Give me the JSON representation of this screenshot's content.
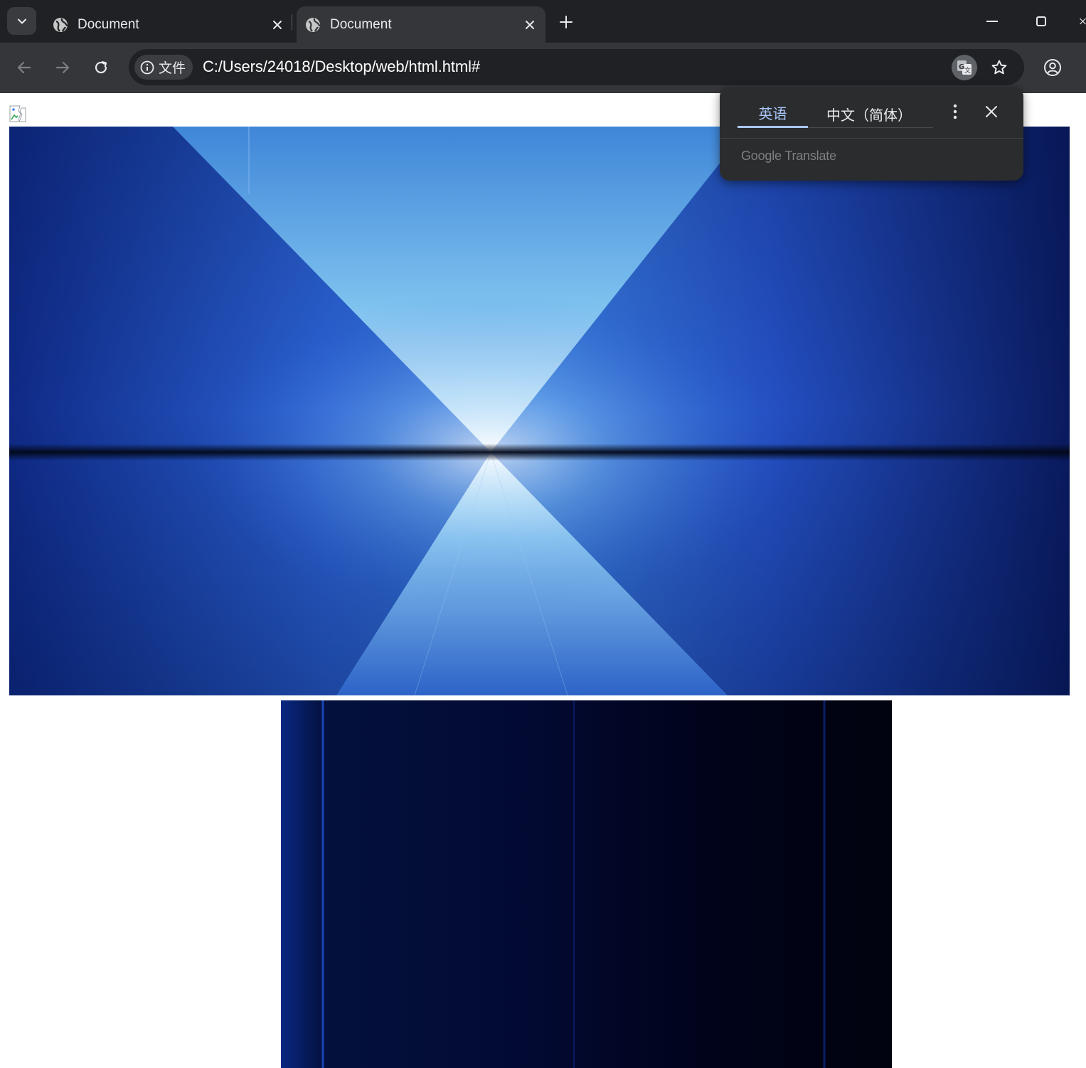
{
  "tabs": [
    {
      "title": "Document",
      "favicon": "globe-icon"
    },
    {
      "title": "Document",
      "favicon": "globe-icon"
    }
  ],
  "toolbar": {
    "site_chip_label": "文件",
    "url": "C:/Users/24018/Desktop/web/html.html#"
  },
  "translate_bubble": {
    "source_language": "英语",
    "target_language": "中文（简体）",
    "brand": "Google Translate"
  },
  "colors": {
    "tabstrip_bg": "#202124",
    "toolbar_bg": "#35363a",
    "bubble_accent": "#a8c7fa",
    "hero_blue": "#2a63d6"
  }
}
